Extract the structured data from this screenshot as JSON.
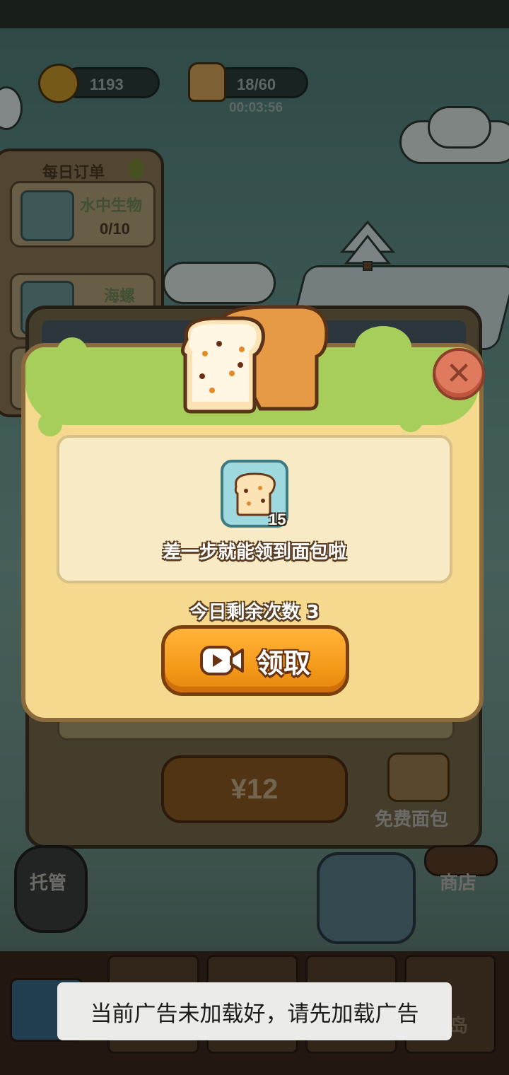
{
  "hud": {
    "coins": "1193",
    "bread": "18/60",
    "timer": "00:03:56"
  },
  "orders": {
    "title": "每日订单",
    "items": [
      {
        "name": "水中生物",
        "progress": "0/10"
      },
      {
        "name": "海螺"
      }
    ]
  },
  "shop": {
    "price_label": "¥12",
    "free_bread_label": "免费面包",
    "shop_label": "商店",
    "auto_label": "托管",
    "island_label": "岛"
  },
  "modal": {
    "item_count": "15",
    "message": "差一步就能领到面包啦",
    "remaining": "今日剩余次数 3",
    "claim_label": "领取",
    "close_icon": "close-icon"
  },
  "toast": {
    "text": "当前广告未加载好，请先加载广告"
  },
  "colors": {
    "modal_bg": "#f5d98e",
    "slime_green": "#a7cd5b",
    "claim_orange": "#f59a1a",
    "close_red": "#e07a5f"
  }
}
